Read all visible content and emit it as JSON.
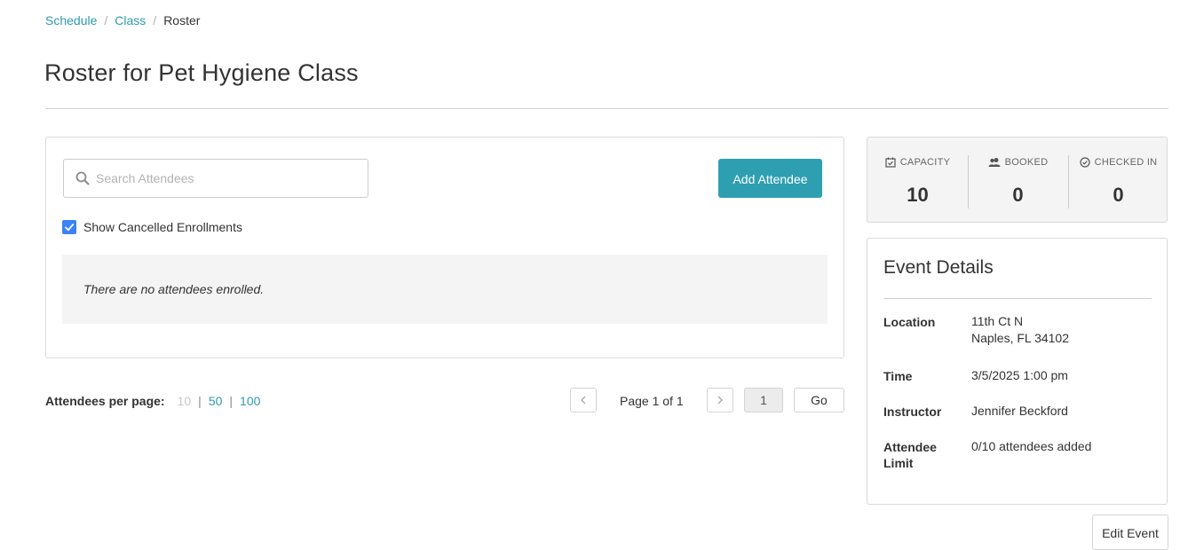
{
  "breadcrumb": {
    "items": [
      "Schedule",
      "Class"
    ],
    "current": "Roster",
    "separator": "/"
  },
  "page_title": "Roster for Pet Hygiene Class",
  "roster": {
    "search_placeholder": "Search Attendees",
    "search_value": "",
    "add_button": "Add Attendee",
    "show_cancelled_label": "Show Cancelled Enrollments",
    "show_cancelled_checked": true,
    "empty_message": "There are no attendees enrolled."
  },
  "pagination": {
    "per_page_label": "Attendees per page:",
    "per_page_options": [
      "10",
      "50",
      "100"
    ],
    "per_page_selected": "10",
    "page_label": "Page 1 of 1",
    "page_input": "1",
    "go_button": "Go"
  },
  "stats": [
    {
      "label": "CAPACITY",
      "value": "10",
      "icon": "calendar-check-icon"
    },
    {
      "label": "BOOKED",
      "value": "0",
      "icon": "users-icon"
    },
    {
      "label": "CHECKED IN",
      "value": "0",
      "icon": "check-circle-icon"
    }
  ],
  "event_details": {
    "title": "Event Details",
    "location_label": "Location",
    "location_line1": "11th Ct N",
    "location_line2": "Naples, FL 34102",
    "time_label": "Time",
    "time_value": "3/5/2025 1:00 pm",
    "instructor_label": "Instructor",
    "instructor_value": "Jennifer Beckford",
    "limit_label_line1": "Attendee",
    "limit_label_line2": "Limit",
    "limit_value": "0/10 attendees added"
  },
  "edit_button": "Edit Event",
  "colors": {
    "accent": "#2e9fb1",
    "link": "#2e9bb0",
    "checkbox": "#3b82f6"
  }
}
